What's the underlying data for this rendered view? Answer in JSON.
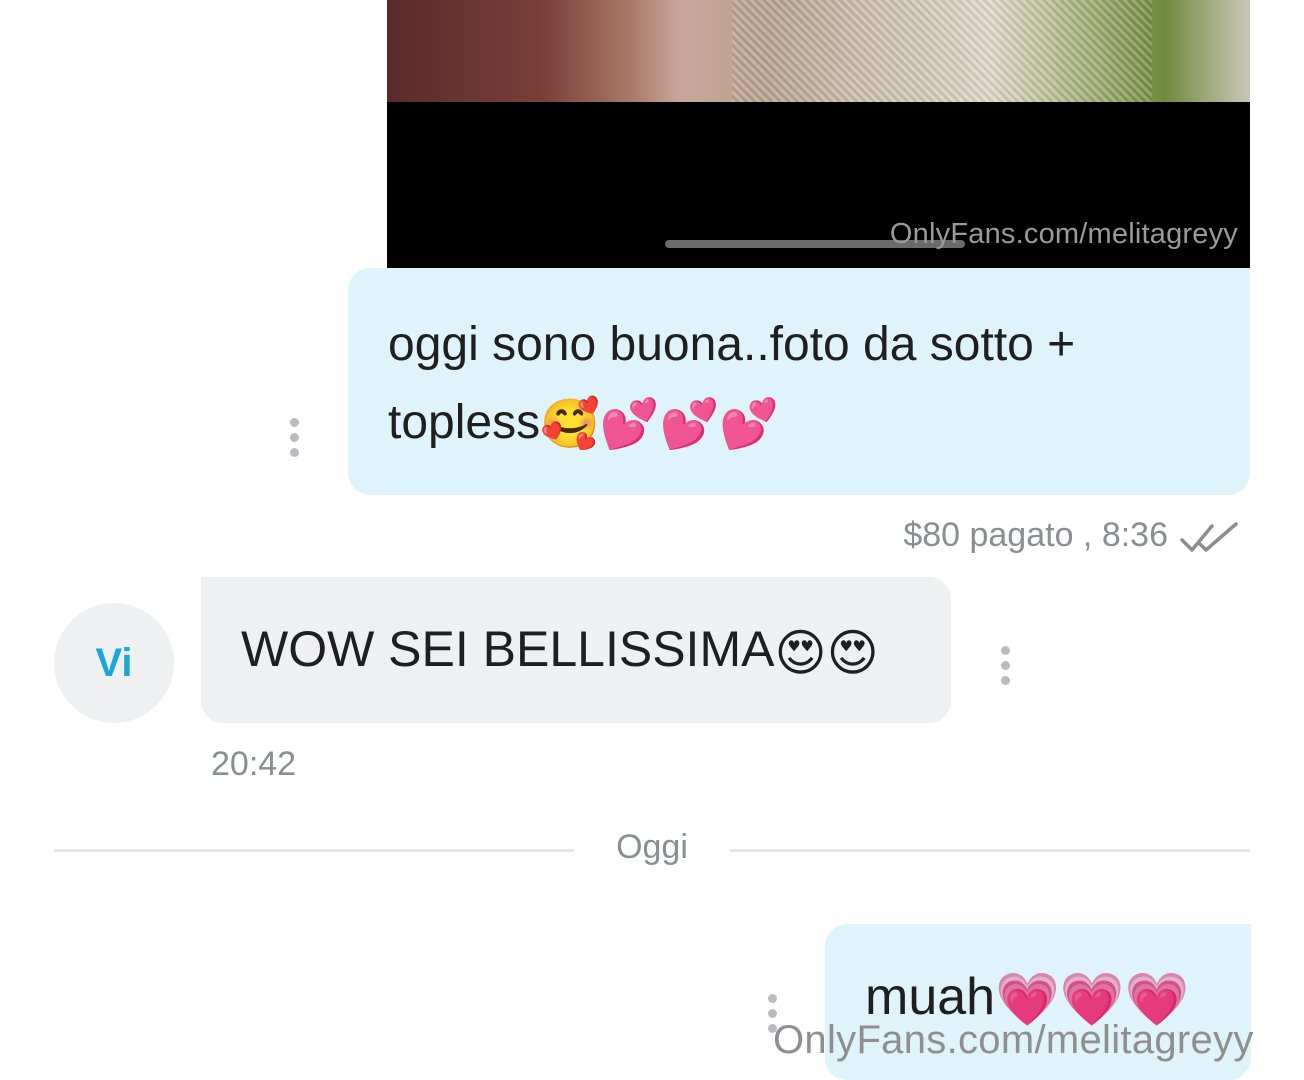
{
  "media": {
    "watermark": "OnlyFans.com/melitagreyy"
  },
  "messages": [
    {
      "direction": "outgoing",
      "text": "oggi sono buona..foto da sotto + topless",
      "emojis": "🥰💕💕💕",
      "meta": "$80 pagato , 8:36",
      "status_icon": "double-check-icon"
    },
    {
      "direction": "incoming",
      "avatar_initials": "Vi",
      "text": "WOW SEI BELLISSIMA",
      "emojis": "😍😍",
      "time": "20:42"
    },
    {
      "direction": "outgoing",
      "text": "muah",
      "emojis": "💗💗💗"
    }
  ],
  "date_divider": "Oggi",
  "footer_watermark": "OnlyFans.com/melitagreyy",
  "colors": {
    "outgoing_bubble": "#dff3fb",
    "incoming_bubble": "#eef0f2",
    "avatar_text": "#1aa6d9",
    "meta_text": "#8a8d91"
  }
}
